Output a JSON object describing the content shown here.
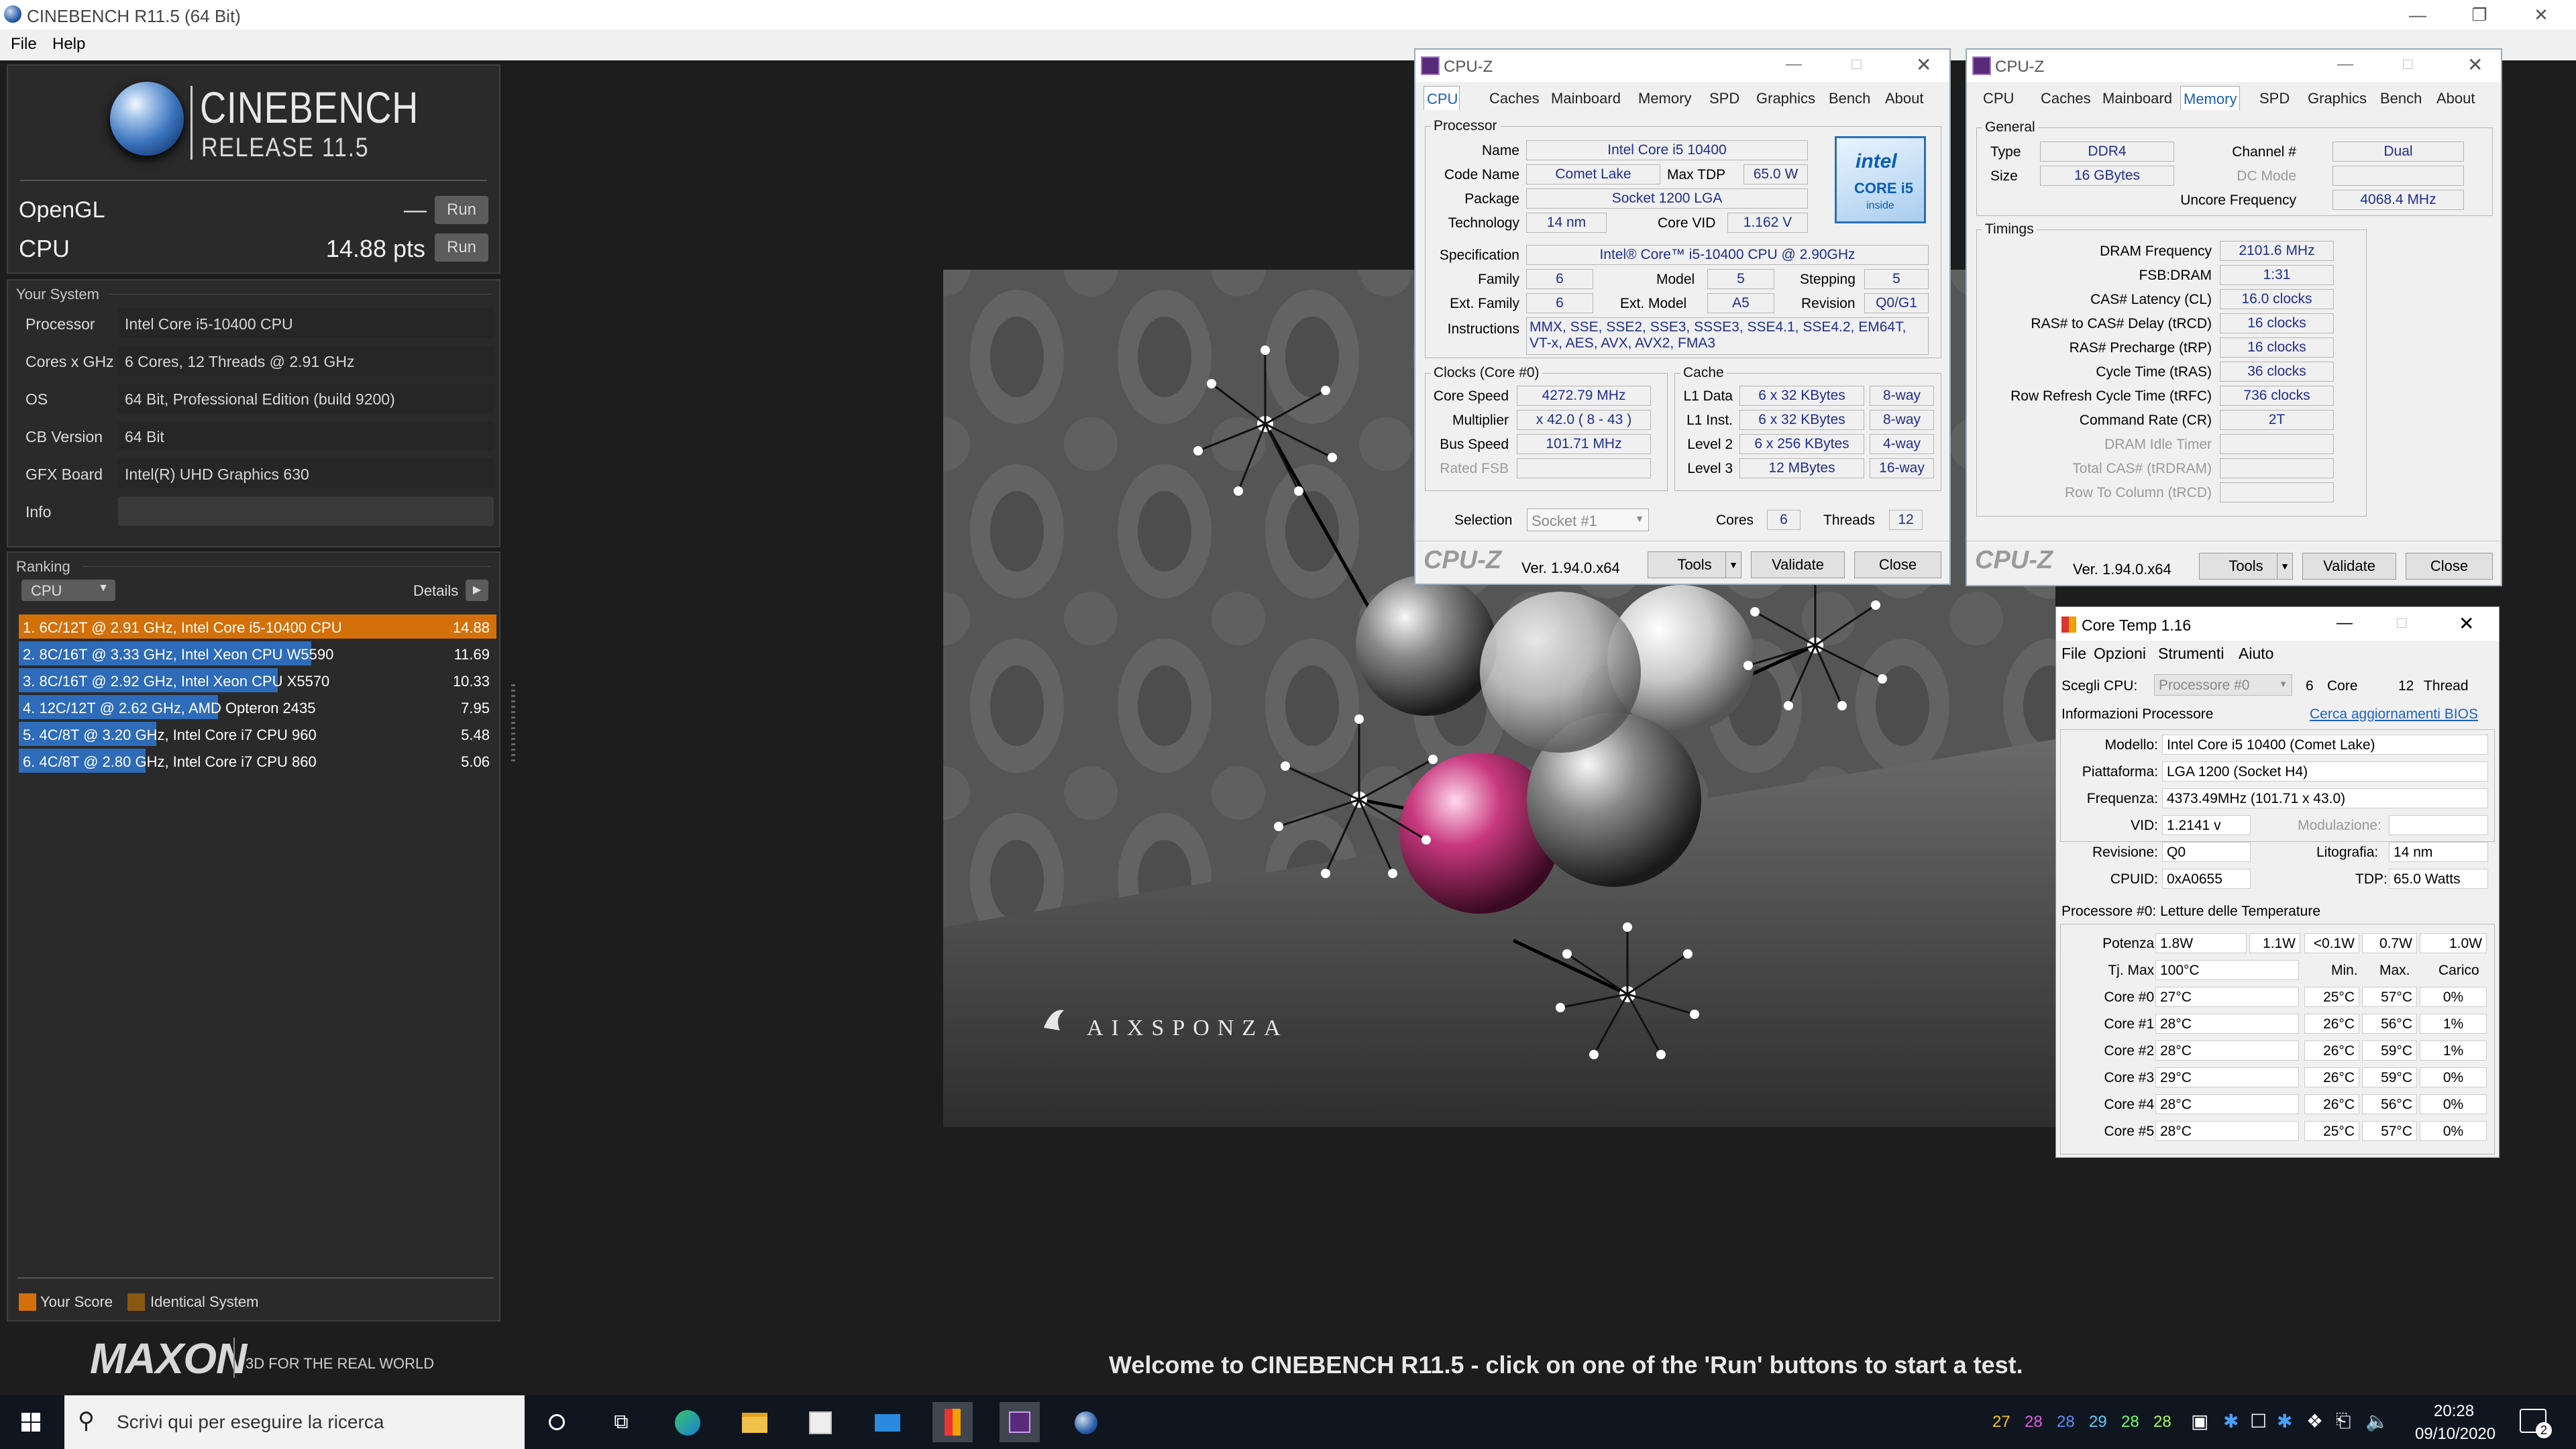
{
  "window": {
    "title": "CINEBENCH R11.5 (64 Bit)"
  },
  "menu": [
    "File",
    "Help"
  ],
  "logo": {
    "name": "CINEBENCH",
    "release": "RELEASE 11.5"
  },
  "scores": {
    "opengl_label": "OpenGL",
    "opengl_value": "—",
    "cpu_label": "CPU",
    "cpu_value": "14.88 pts",
    "run": "Run"
  },
  "system": {
    "title": "Your System",
    "rows": [
      {
        "k": "Processor",
        "v": "Intel Core i5-10400 CPU"
      },
      {
        "k": "Cores x GHz",
        "v": "6 Cores, 12 Threads @ 2.91 GHz"
      },
      {
        "k": "OS",
        "v": "64 Bit, Professional Edition (build 9200)"
      },
      {
        "k": "CB Version",
        "v": "64 Bit"
      },
      {
        "k": "GFX Board",
        "v": "Intel(R) UHD Graphics 630"
      },
      {
        "k": "Info",
        "v": ""
      }
    ]
  },
  "ranking": {
    "title": "Ranking",
    "dropdown": "CPU",
    "details": "Details",
    "rows": [
      {
        "label": "1. 6C/12T @ 2.91 GHz, Intel Core i5-10400 CPU",
        "score": "14.88",
        "value": 14.88,
        "color": "#d4700a"
      },
      {
        "label": "2. 8C/16T @ 3.33 GHz, Intel Xeon CPU W5590",
        "score": "11.69",
        "value": 11.69,
        "color": "#2e6bb8"
      },
      {
        "label": "3. 8C/16T @ 2.92 GHz, Intel Xeon CPU X5570",
        "score": "10.33",
        "value": 10.33,
        "color": "#2e6bb8"
      },
      {
        "label": "4. 12C/12T @ 2.62 GHz, AMD Opteron 2435",
        "score": "7.95",
        "value": 7.95,
        "color": "#2e6bb8"
      },
      {
        "label": "5. 4C/8T @ 3.20 GHz, Intel Core i7 CPU 960",
        "score": "5.48",
        "value": 5.48,
        "color": "#2e6bb8"
      },
      {
        "label": "6. 4C/8T @ 2.80 GHz, Intel Core i7 CPU 860",
        "score": "5.06",
        "value": 5.06,
        "color": "#2e6bb8"
      }
    ],
    "legend_your": "Your Score",
    "legend_identical": "Identical System"
  },
  "maxon": {
    "brand": "MAXON",
    "tagline": "3D FOR THE REAL WORLD"
  },
  "render": {
    "watermark": "AIXSPONZA"
  },
  "welcome": "Welcome to CINEBENCH R11.5 - click on one of the 'Run' buttons to start a test.",
  "cpuz_common": {
    "title": "CPU-Z",
    "tabs": [
      "CPU",
      "Caches",
      "Mainboard",
      "Memory",
      "SPD",
      "Graphics",
      "Bench",
      "About"
    ],
    "logo": "CPU-Z",
    "version": "Ver. 1.94.0.x64",
    "tools": "Tools",
    "validate": "Validate",
    "close": "Close"
  },
  "cpuz1": {
    "group_processor": "Processor",
    "name": "Intel Core i5 10400",
    "code_name": "Comet Lake",
    "max_tdp": "65.0 W",
    "package": "Socket 1200 LGA",
    "technology": "14 nm",
    "core_vid": "1.162 V",
    "specification": "Intel® Core™ i5-10400 CPU @ 2.90GHz",
    "family": "6",
    "model": "5",
    "stepping": "5",
    "ext_family": "6",
    "ext_model": "A5",
    "revision": "Q0/G1",
    "instructions": "MMX, SSE, SSE2, SSE3, SSSE3, SSE4.1, SSE4.2, EM64T, VT-x, AES, AVX, AVX2, FMA3",
    "labels": {
      "name": "Name",
      "code_name": "Code Name",
      "max_tdp": "Max TDP",
      "package": "Package",
      "technology": "Technology",
      "core_vid": "Core VID",
      "specification": "Specification",
      "family": "Family",
      "model": "Model",
      "stepping": "Stepping",
      "ext_family": "Ext. Family",
      "ext_model": "Ext. Model",
      "revision": "Revision",
      "instructions": "Instructions"
    },
    "intel_badge": {
      "brand": "intel",
      "line": "CORE i5",
      "sub": "inside"
    },
    "clocks": {
      "title": "Clocks (Core #0)",
      "core_speed_l": "Core Speed",
      "core_speed": "4272.79 MHz",
      "multiplier_l": "Multiplier",
      "multiplier": "x 42.0 ( 8 - 43 )",
      "bus_speed_l": "Bus Speed",
      "bus_speed": "101.71 MHz",
      "rated_fsb_l": "Rated FSB",
      "rated_fsb": ""
    },
    "cache": {
      "title": "Cache",
      "rows": [
        {
          "k": "L1 Data",
          "v": "6 x 32 KBytes",
          "w": "8-way"
        },
        {
          "k": "L1 Inst.",
          "v": "6 x 32 KBytes",
          "w": "8-way"
        },
        {
          "k": "Level 2",
          "v": "6 x 256 KBytes",
          "w": "4-way"
        },
        {
          "k": "Level 3",
          "v": "12 MBytes",
          "w": "16-way"
        }
      ]
    },
    "selection_l": "Selection",
    "selection": "Socket #1",
    "cores_l": "Cores",
    "cores": "6",
    "threads_l": "Threads",
    "threads": "12"
  },
  "cpuz2": {
    "general": {
      "title": "General",
      "type_l": "Type",
      "type": "DDR4",
      "channel_l": "Channel #",
      "channel": "Dual",
      "size_l": "Size",
      "size": "16 GBytes",
      "dcmode_l": "DC Mode",
      "dcmode": "",
      "uncore_l": "Uncore Frequency",
      "uncore": "4068.4 MHz"
    },
    "timings": {
      "title": "Timings",
      "rows": [
        {
          "k": "DRAM Frequency",
          "v": "2101.6 MHz",
          "grey": false
        },
        {
          "k": "FSB:DRAM",
          "v": "1:31",
          "grey": false
        },
        {
          "k": "CAS# Latency (CL)",
          "v": "16.0 clocks",
          "grey": false
        },
        {
          "k": "RAS# to CAS# Delay (tRCD)",
          "v": "16 clocks",
          "grey": false
        },
        {
          "k": "RAS# Precharge (tRP)",
          "v": "16 clocks",
          "grey": false
        },
        {
          "k": "Cycle Time (tRAS)",
          "v": "36 clocks",
          "grey": false
        },
        {
          "k": "Row Refresh Cycle Time (tRFC)",
          "v": "736 clocks",
          "grey": false
        },
        {
          "k": "Command Rate (CR)",
          "v": "2T",
          "grey": false
        },
        {
          "k": "DRAM Idle Timer",
          "v": "",
          "grey": true
        },
        {
          "k": "Total CAS# (tRDRAM)",
          "v": "",
          "grey": true
        },
        {
          "k": "Row To Column (tRCD)",
          "v": "",
          "grey": true
        }
      ]
    }
  },
  "coretemp": {
    "title": "Core Temp 1.16",
    "menu": [
      "File",
      "Opzioni",
      "Strumenti",
      "Aiuto"
    ],
    "scegli_cpu": "Scegli CPU:",
    "processor_sel": "Processore #0",
    "cores": "6",
    "core_l": "Core",
    "threads": "12",
    "thread_l": "Thread",
    "info_l": "Informazioni Processore",
    "bios_link": "Cerca aggiornamenti BIOS",
    "modello_l": "Modello:",
    "modello": "Intel Core i5 10400 (Comet Lake)",
    "piattaforma_l": "Piattaforma:",
    "piattaforma": "LGA 1200 (Socket H4)",
    "frequenza_l": "Frequenza:",
    "frequenza": "4373.49MHz (101.71 x 43.0)",
    "vid_l": "VID:",
    "vid": "1.2141 v",
    "modulazione_l": "Modulazione:",
    "modulazione": "",
    "revisione_l": "Revisione:",
    "revisione": "Q0",
    "litografia_l": "Litografia:",
    "litografia": "14 nm",
    "cpuid_l": "CPUID:",
    "cpuid": "0xA0655",
    "tdp_l": "TDP:",
    "tdp": "65.0 Watts",
    "temps_title": "Processore #0: Letture delle Temperature",
    "potenza_l": "Potenza:",
    "potenza": [
      "1.8W",
      "1.1W",
      "<0.1W",
      "0.7W",
      "1.0W"
    ],
    "tjmax_l": "Tj. Max:",
    "tjmax": "100°C",
    "min_l": "Min.",
    "max_l": "Max.",
    "carico_l": "Carico",
    "cores_rows": [
      {
        "k": "Core #0:",
        "t": "27°C",
        "min": "25°C",
        "max": "57°C",
        "load": "0%"
      },
      {
        "k": "Core #1:",
        "t": "28°C",
        "min": "26°C",
        "max": "56°C",
        "load": "1%"
      },
      {
        "k": "Core #2:",
        "t": "28°C",
        "min": "26°C",
        "max": "59°C",
        "load": "1%"
      },
      {
        "k": "Core #3:",
        "t": "29°C",
        "min": "26°C",
        "max": "59°C",
        "load": "0%"
      },
      {
        "k": "Core #4:",
        "t": "28°C",
        "min": "26°C",
        "max": "56°C",
        "load": "0%"
      },
      {
        "k": "Core #5:",
        "t": "28°C",
        "min": "25°C",
        "max": "57°C",
        "load": "0%"
      }
    ]
  },
  "taskbar": {
    "search_placeholder": "Scrivi qui per eseguire la ricerca",
    "tray_temps": [
      "27",
      "28",
      "28",
      "29",
      "28",
      "28"
    ],
    "tray_colors": [
      "#f5c518",
      "#e05ce0",
      "#5c8cff",
      "#5cd0ff",
      "#6cff6c",
      "#a8ff5c"
    ],
    "time": "20:28",
    "date": "09/10/2020",
    "notif_count": "2"
  }
}
